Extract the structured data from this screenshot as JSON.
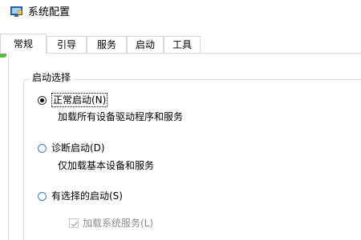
{
  "window": {
    "title": "系统配置",
    "icon": "system-config-icon"
  },
  "tabs": [
    {
      "label": "常规",
      "active": true
    },
    {
      "label": "引导",
      "active": false
    },
    {
      "label": "服务",
      "active": false
    },
    {
      "label": "启动",
      "active": false
    },
    {
      "label": "工具",
      "active": false
    }
  ],
  "general": {
    "group_title": "启动选择",
    "options": [
      {
        "label": "正常启动(N)",
        "description": "加载所有设备驱动程序和服务",
        "selected": true
      },
      {
        "label": "诊断启动(D)",
        "description": "仅加载基本设备和服务",
        "selected": false
      },
      {
        "label": "有选择的启动(S)",
        "selected": false
      }
    ],
    "load_system_services": {
      "label": "加载系统服务(L)",
      "checked": true,
      "disabled": true
    }
  },
  "colors": {
    "accent_green": "#5dbb4a",
    "border": "#d9d9d9",
    "disabled_text": "#8c8c8c"
  }
}
